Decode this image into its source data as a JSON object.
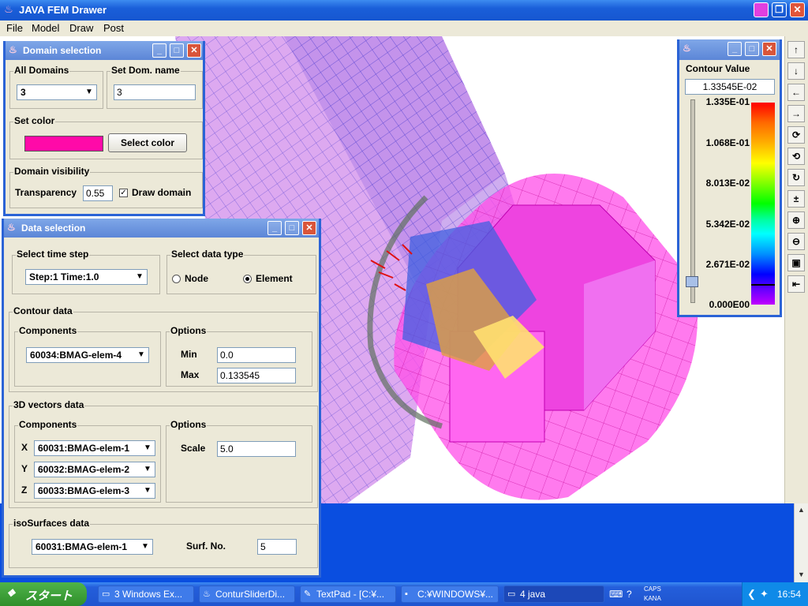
{
  "window": {
    "title": "JAVA FEM Drawer",
    "buttons": {
      "minimize": "_",
      "maximize": "❐",
      "close": "✕"
    }
  },
  "menu": [
    "File",
    "Model",
    "Draw",
    "Post"
  ],
  "domain_panel": {
    "title": "Domain selection",
    "all_domains_label": "All Domains",
    "all_domains_value": "3",
    "set_dom_name_label": "Set Dom. name",
    "set_dom_name_value": "3",
    "set_color_label": "Set color",
    "color": "#ff0aa8",
    "select_color_button": "Select color",
    "visibility_label": "Domain visibility",
    "transparency_label": "Transparency",
    "transparency_value": "0.55",
    "draw_domain_label": "Draw domain"
  },
  "data_panel": {
    "title": "Data selection",
    "time_step_label": "Select time step",
    "time_step_value": "Step:1 Time:1.0",
    "data_type_label": "Select data type",
    "node_label": "Node",
    "element_label": "Element",
    "contour_label": "Contour data",
    "components_label": "Components",
    "options_label": "Options",
    "contour_component": "60034:BMAG-elem-4",
    "min_label": "Min",
    "min_value": "0.0",
    "max_label": "Max",
    "max_value": "0.133545",
    "vectors_label": "3D vectors data",
    "vx_label": "X",
    "vx_value": "60031:BMAG-elem-1",
    "vy_label": "Y",
    "vy_value": "60032:BMAG-elem-2",
    "vz_label": "Z",
    "vz_value": "60033:BMAG-elem-3",
    "scale_label": "Scale",
    "scale_value": "5.0",
    "iso_label": "isoSurfaces data",
    "iso_component": "60031:BMAG-elem-1",
    "surf_no_label": "Surf. No.",
    "surf_no_value": "5"
  },
  "contour_panel": {
    "title_label": "Contour Value",
    "current_value": "1.33545E-02",
    "scale_labels": [
      "1.335E-01",
      "1.068E-01",
      "8.013E-02",
      "5.342E-02",
      "2.671E-02",
      "0.000E00"
    ],
    "slider_level": 0.1
  },
  "toolbar_icons": [
    "up-arrow-icon",
    "down-arrow-icon",
    "left-arrow-icon",
    "right-arrow-icon",
    "rotate-x-icon",
    "rotate-y-icon",
    "rotate-z-icon",
    "plus-minus-icon",
    "zoom-in-icon",
    "zoom-out-icon",
    "fit-icon",
    "back-arrow-icon"
  ],
  "taskbar": {
    "start": "スタート",
    "tasks": [
      {
        "label": "3 Windows Ex...",
        "icon": "folder-icon"
      },
      {
        "label": "ConturSliderDi...",
        "icon": "java-icon"
      },
      {
        "label": "TextPad - [C:¥...",
        "icon": "textpad-icon"
      },
      {
        "label": "C:¥WINDOWS¥...",
        "icon": "cmd-icon"
      },
      {
        "label": "4 java",
        "icon": "java-window-icon"
      }
    ],
    "ime_caps": "CAPS",
    "ime_kana": "KANA",
    "clock": "16:54"
  }
}
